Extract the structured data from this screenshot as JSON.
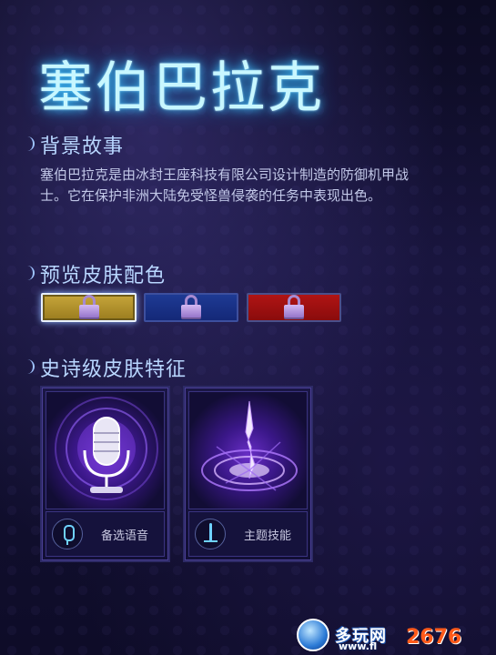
{
  "hero": {
    "title": "塞伯巴拉克"
  },
  "sections": {
    "story": {
      "heading": "背景故事",
      "text": "塞伯巴拉克是由冰封王座科技有限公司设计制造的防御机甲战\n士。它在保护非洲大陆免受怪兽侵袭的任务中表现出色。"
    },
    "skins": {
      "heading": "预览皮肤配色",
      "swatches": [
        {
          "name": "gold",
          "color": "#c7a63b",
          "locked": true,
          "selected": true
        },
        {
          "name": "blue",
          "color": "#1e3a94",
          "locked": true,
          "selected": false
        },
        {
          "name": "red",
          "color": "#b01414",
          "locked": true,
          "selected": false
        }
      ]
    },
    "features": {
      "heading": "史诗级皮肤特征",
      "cards": [
        {
          "label": "备选语音",
          "icon": "microphone-icon"
        },
        {
          "label": "主题技能",
          "icon": "sword-icon"
        }
      ]
    }
  },
  "watermark": {
    "text": "多玩网",
    "sub": "www.fl",
    "num": "2676"
  },
  "colors": {
    "title_glow": "#3fc7ff",
    "heading": "#b8d6ff",
    "card_border": "#2d2a66",
    "accent_purple": "#6a2fc8"
  }
}
